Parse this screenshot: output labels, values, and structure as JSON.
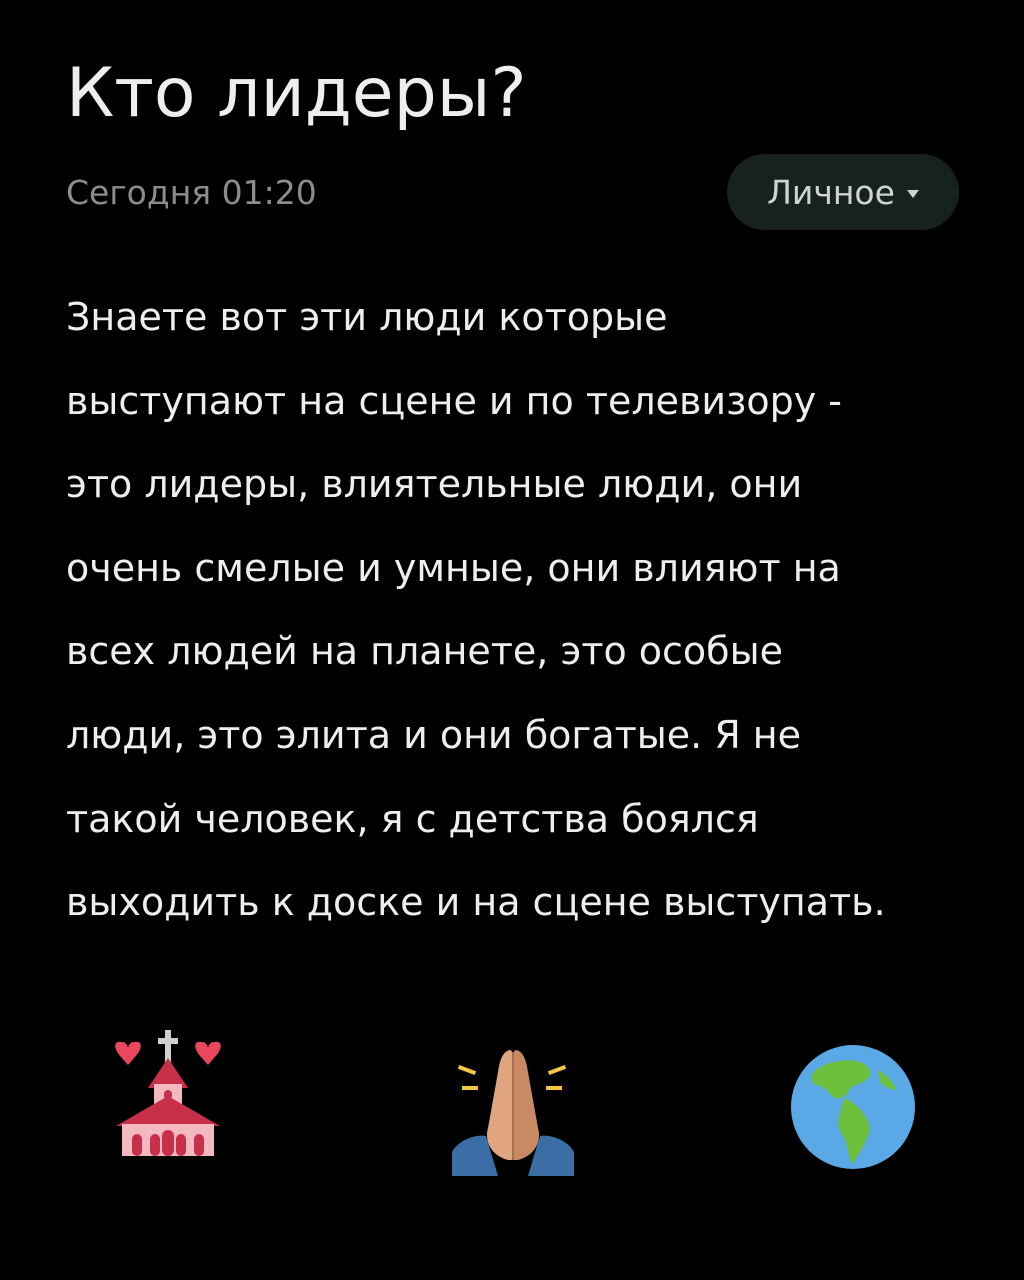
{
  "note": {
    "title": "Кто лидеры?",
    "timestamp": "Сегодня 01:20",
    "category": {
      "label": "Личное",
      "icon": "caret-down-icon"
    },
    "body_lines": [
      "Знаете вот эти люди которые",
      "выступают на сцене и по телевизору -",
      "это лидеры, влиятельные люди, они",
      "очень смелые и умные, они влияют на",
      "всех людей на планете, это особые",
      "люди, это элита и они богатые. Я не",
      "такой человек, я с детства боялся",
      "выходить к доске и на сцене выступать."
    ],
    "emojis": [
      "wedding-church-icon",
      "folded-hands-icon",
      "globe-americas-icon"
    ]
  },
  "colors": {
    "background": "#000000",
    "text": "#eeeeee",
    "timestamp": "#8c8c8c",
    "chip_bg": "#17221f"
  }
}
